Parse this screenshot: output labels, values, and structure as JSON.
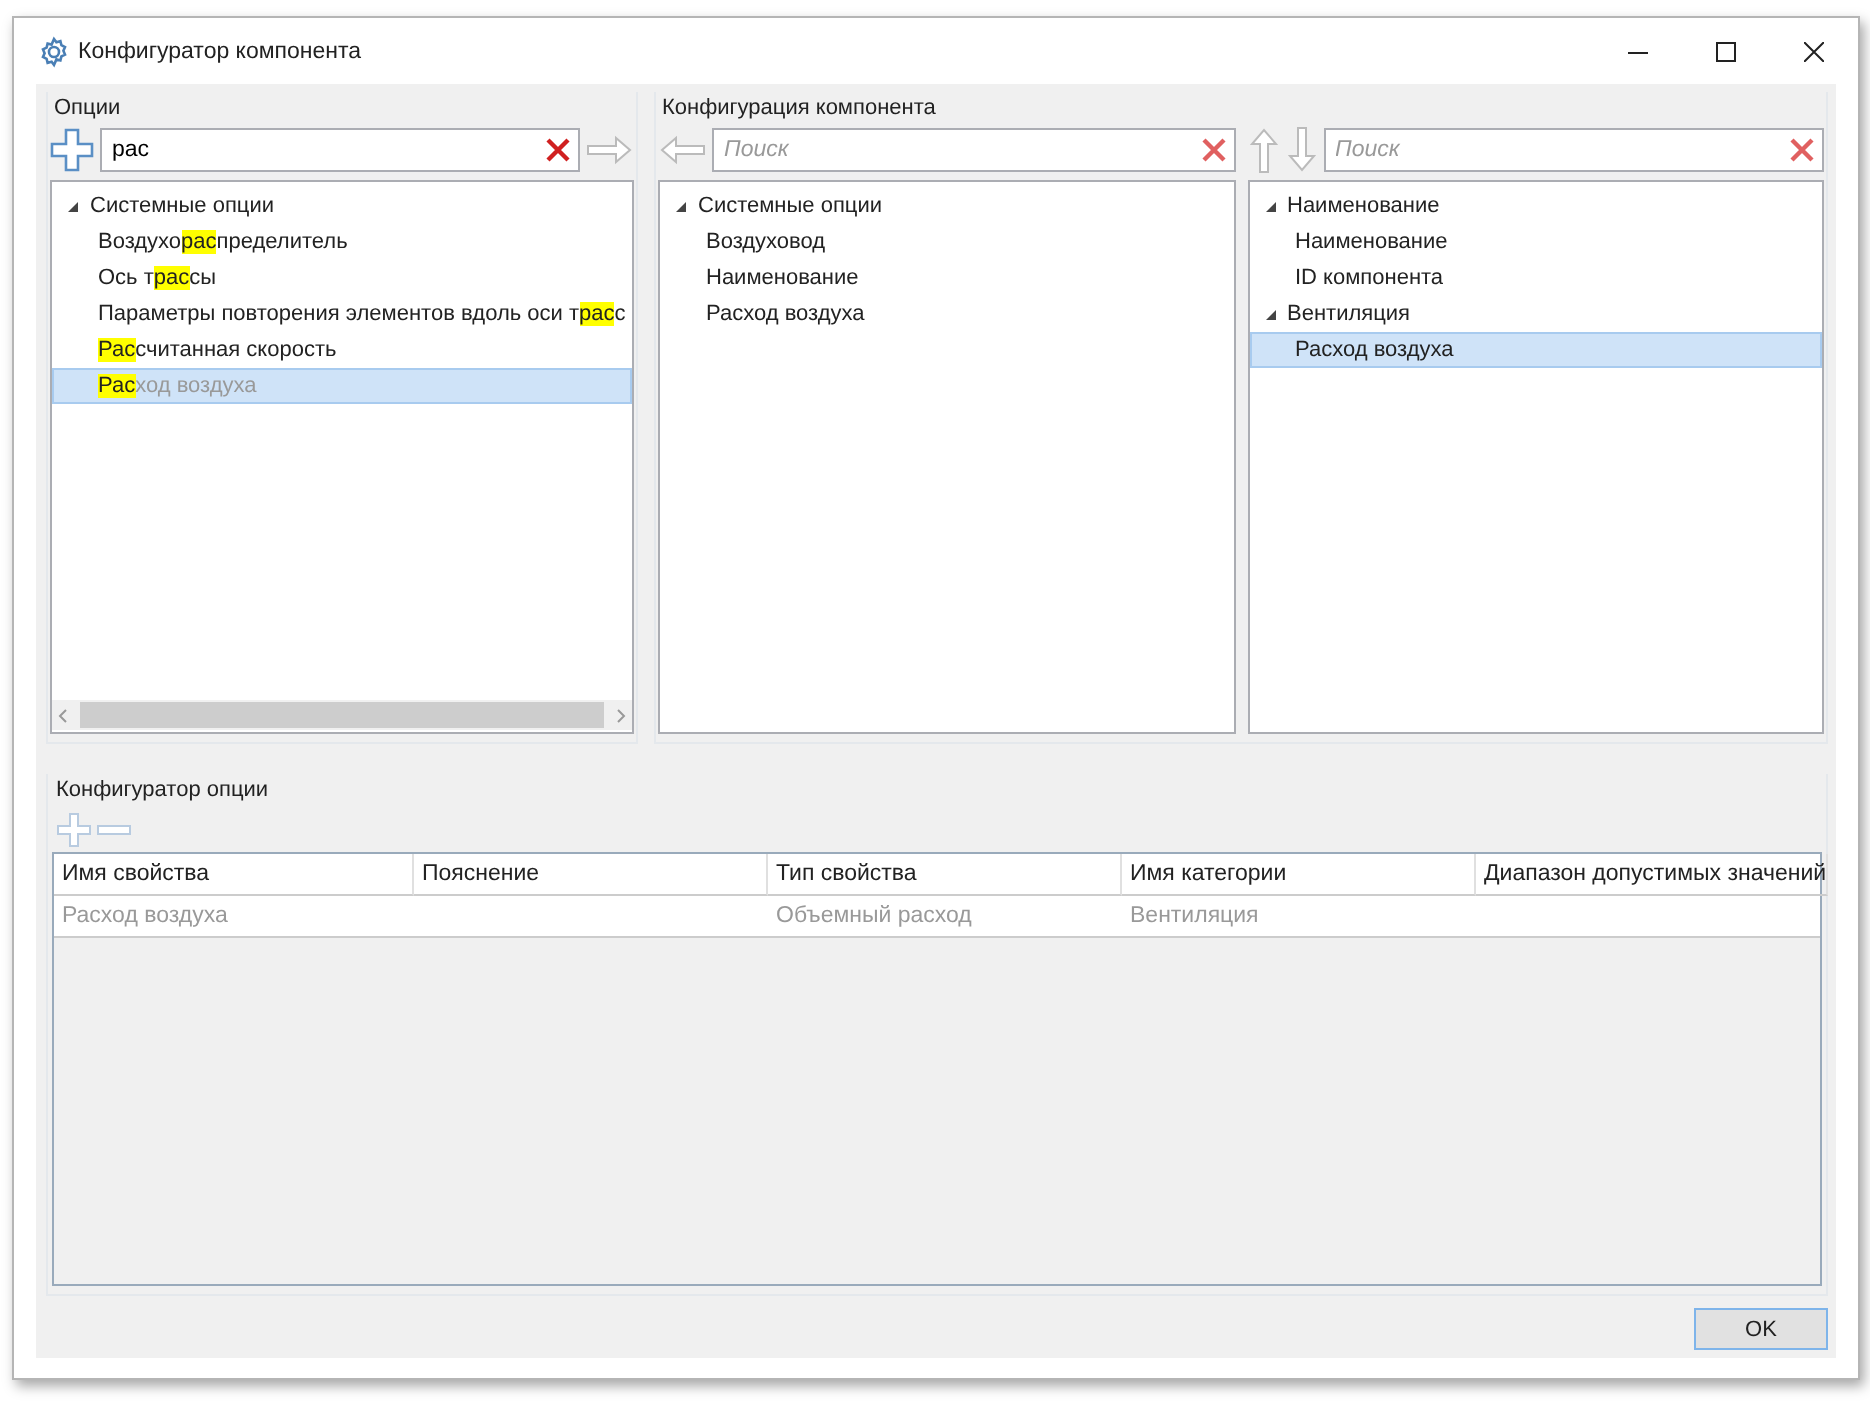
{
  "window": {
    "title": "Конфигуратор компонента"
  },
  "options": {
    "title": "Опции",
    "search": {
      "value": "рас"
    },
    "tree": [
      {
        "label": [
          {
            "text": "Системные опции",
            "match": false
          }
        ],
        "expanded": true,
        "children": [
          {
            "label": [
              {
                "text": "Воздухо",
                "match": false
              },
              {
                "text": "рас",
                "match": true
              },
              {
                "text": "пределитель",
                "match": false
              }
            ],
            "selected": false,
            "disabled": false
          },
          {
            "label": [
              {
                "text": "Ось т",
                "match": false
              },
              {
                "text": "рас",
                "match": true
              },
              {
                "text": "сы",
                "match": false
              }
            ],
            "selected": false,
            "disabled": false
          },
          {
            "label": [
              {
                "text": "Параметры повторения элементов вдоль оси т",
                "match": false
              },
              {
                "text": "рас",
                "match": true
              },
              {
                "text": "с",
                "match": false
              }
            ],
            "selected": false,
            "disabled": false
          },
          {
            "label": [
              {
                "text": "Рас",
                "match": true
              },
              {
                "text": "считанная скорость",
                "match": false
              }
            ],
            "selected": false,
            "disabled": false
          },
          {
            "label": [
              {
                "text": "Рас",
                "match": true
              },
              {
                "text": "ход воздуха",
                "match": false
              }
            ],
            "selected": true,
            "disabled": true
          }
        ]
      }
    ]
  },
  "configuration": {
    "title": "Конфигурация компонента",
    "left": {
      "search": {
        "placeholder": "Поиск"
      },
      "tree": [
        {
          "label": "Системные опции",
          "expanded": true,
          "children": [
            {
              "label": "Воздуховод",
              "selected": false
            },
            {
              "label": "Наименование",
              "selected": false
            },
            {
              "label": "Расход воздуха",
              "selected": false
            }
          ]
        }
      ]
    },
    "right": {
      "search": {
        "placeholder": "Поиск"
      },
      "tree": [
        {
          "label": "Наименование",
          "expanded": true,
          "children": [
            {
              "label": "Наименование",
              "selected": false
            },
            {
              "label": "ID компонента",
              "selected": false
            }
          ]
        },
        {
          "label": "Вентиляция",
          "expanded": true,
          "children": [
            {
              "label": "Расход воздуха",
              "selected": true
            }
          ]
        }
      ]
    }
  },
  "option_configurator": {
    "title": "Конфигуратор опции",
    "table": {
      "columns": [
        "Имя свойства",
        "Пояснение",
        "Тип свойства",
        "Имя категории",
        "Диапазон допустимых значений"
      ],
      "rows": [
        {
          "cells": [
            "Расход воздуха",
            "",
            "Объемный расход",
            "Вентиляция",
            ""
          ],
          "disabled": true
        }
      ]
    }
  },
  "buttons": [
    "OK"
  ]
}
